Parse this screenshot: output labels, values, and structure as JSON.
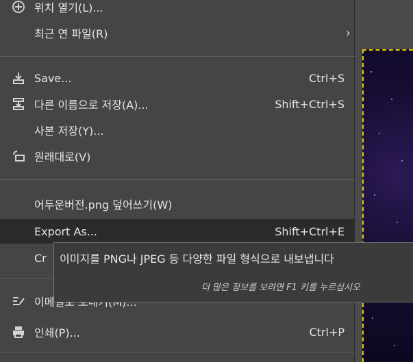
{
  "menu": {
    "items": [
      {
        "label": "위치 열기(L)...",
        "shortcut": "",
        "icon": "open-location-icon"
      },
      {
        "label": "최근 연 파일(R)",
        "shortcut": "",
        "icon": "",
        "submenu_arrow": "›"
      },
      {
        "label": "Save...",
        "shortcut": "Ctrl+S",
        "icon": "save-icon"
      },
      {
        "label": "다른 이름으로 저장(A)...",
        "shortcut": "Shift+Ctrl+S",
        "icon": "save-as-icon"
      },
      {
        "label": "사본 저장(Y)...",
        "shortcut": "",
        "icon": ""
      },
      {
        "label": "원래대로(V)",
        "shortcut": "",
        "icon": "revert-icon"
      },
      {
        "label": "어두운버전.png 덮어쓰기(W)",
        "shortcut": "",
        "icon": ""
      },
      {
        "label": "Export As...",
        "shortcut": "Shift+Ctrl+E",
        "icon": ""
      },
      {
        "label": "Cr",
        "shortcut": "",
        "icon": ""
      },
      {
        "label": "이메일로 보내기(M)...",
        "shortcut": "",
        "icon": "email-edit-icon"
      },
      {
        "label": "인쇄(P)...",
        "shortcut": "Ctrl+P",
        "icon": "print-icon"
      }
    ]
  },
  "tooltip": {
    "main": "이미지를 PNG나 JPEG 등 다양한 파일 형식으로 내보냅니다",
    "hint": "더 많은 정보를 보려면 F1 키를 누르십시오"
  },
  "colors": {
    "menu_bg": "#454545",
    "highlight_bg": "#2b2b2b",
    "selection_border": "#e6c800"
  }
}
